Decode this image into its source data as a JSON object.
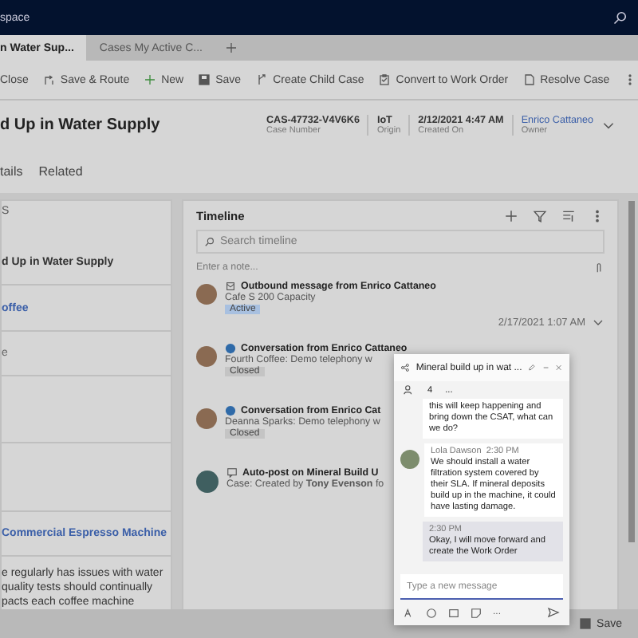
{
  "app_bar": {
    "title": "space"
  },
  "session_tabs": [
    {
      "label": "n Water Sup...",
      "selected": true
    },
    {
      "label": "Cases My Active C...",
      "selected": false
    }
  ],
  "toolbar": [
    "Close",
    "Save & Route",
    "New",
    "Save",
    "Create Child Case",
    "Convert to Work Order",
    "Resolve Case"
  ],
  "record": {
    "title": "d Up in Water Supply",
    "fields": [
      {
        "value": "CAS-47732-V4V6K6",
        "label": "Case Number",
        "kind": "text"
      },
      {
        "value": "IoT",
        "label": "Origin",
        "kind": "text"
      },
      {
        "value": "2/12/2021 4:47 AM",
        "label": "Created On",
        "kind": "text"
      },
      {
        "value": "Enrico Cattaneo",
        "label": "Owner",
        "kind": "link"
      }
    ]
  },
  "form_tabs": [
    "tails",
    "Related"
  ],
  "left_panel": {
    "heading": "S",
    "rows": [
      {
        "value": "d Up in Water Supply",
        "kind": "text"
      },
      {
        "value": "offee",
        "kind": "link"
      },
      {
        "value": "e",
        "kind": "muted"
      },
      {
        "value": "Commercial Espresso Machine",
        "kind": "link"
      }
    ],
    "description": [
      "e regularly has issues with water",
      "quality tests should continually",
      "pacts each coffee machine"
    ]
  },
  "timeline": {
    "title": "Timeline",
    "search_placeholder": "Search timeline",
    "note_placeholder": "Enter a note...",
    "items": [
      {
        "kind": "email",
        "title": "Outbound message from Enrico Cattaneo",
        "subtitle": "Cafe S 200 Capacity",
        "badge": {
          "label": "Active",
          "color": "#a8c0e0"
        },
        "date": "2/17/2021 1:07 AM"
      },
      {
        "kind": "conversation",
        "title": "Conversation from Enrico Cattaneo",
        "subtitle": "Fourth Coffee: Demo telephony w",
        "badge": {
          "label": "Closed",
          "color": "#c4c4c4"
        }
      },
      {
        "kind": "conversation",
        "title": "Conversation from Enrico Cat",
        "subtitle": "Deanna Sparks: Demo telephony w",
        "badge": {
          "label": "Closed",
          "color": "#c4c4c4"
        }
      },
      {
        "kind": "post",
        "title": "Auto-post on Mineral Build U",
        "subtitle": "Case: Created by **Tony Evenson** fo"
      }
    ]
  },
  "chat": {
    "title": "Mineral build up in wat ...",
    "participants": "4",
    "more": "...",
    "messages": [
      {
        "kind": "continued",
        "text": "this will keep happening and bring down the CSAT, what can we do?"
      },
      {
        "kind": "incoming",
        "author": "Lola Dawson",
        "time": "2:30 PM",
        "text": "We should install a water filtration system covered by their SLA. If mineral deposits build up in the machine, it could have lasting damage."
      },
      {
        "kind": "outgoing",
        "time": "2:30 PM",
        "text": "Okay, I will move forward and create the Work Order"
      }
    ],
    "placeholder": "Type a new message",
    "toolbar_more": "..."
  },
  "footer": {
    "save": "Save"
  }
}
